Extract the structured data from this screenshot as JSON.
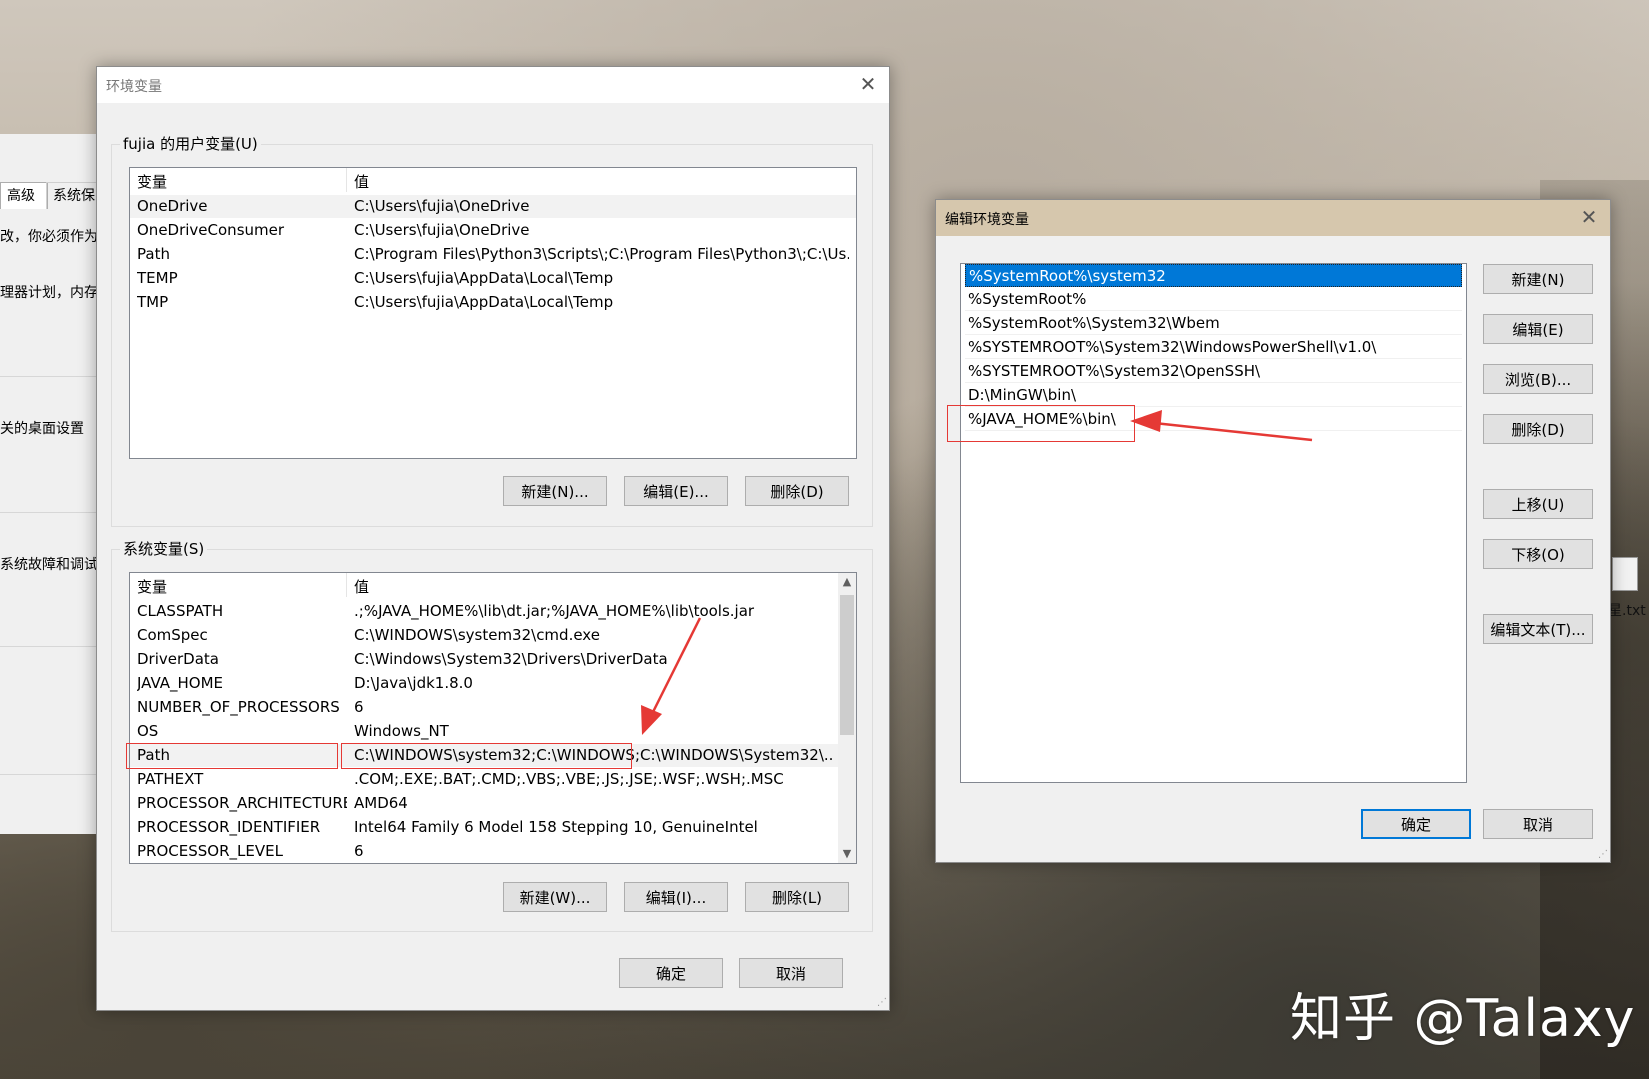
{
  "background": {
    "file_label": "星.txt",
    "watermark": "知乎 @Talaxy"
  },
  "system_properties": {
    "tabs": [
      "高级",
      "系统保"
    ],
    "texts": [
      "改，你必须作为",
      "理器计划，内存",
      "关的桌面设置",
      "系统故障和调试信"
    ]
  },
  "env_dialog": {
    "title": "环境变量",
    "user_group_label": "fujia 的用户变量(U)",
    "columns": [
      "变量",
      "值"
    ],
    "user_vars": [
      {
        "name": "OneDrive",
        "value": "C:\\Users\\fujia\\OneDrive"
      },
      {
        "name": "OneDriveConsumer",
        "value": "C:\\Users\\fujia\\OneDrive"
      },
      {
        "name": "Path",
        "value": "C:\\Program Files\\Python3\\Scripts\\;C:\\Program Files\\Python3\\;C:\\Us..."
      },
      {
        "name": "TEMP",
        "value": "C:\\Users\\fujia\\AppData\\Local\\Temp"
      },
      {
        "name": "TMP",
        "value": "C:\\Users\\fujia\\AppData\\Local\\Temp"
      }
    ],
    "user_buttons": {
      "new": "新建(N)...",
      "edit": "编辑(E)...",
      "delete": "删除(D)"
    },
    "system_group_label": "系统变量(S)",
    "system_vars": [
      {
        "name": "CLASSPATH",
        "value": ".;%JAVA_HOME%\\lib\\dt.jar;%JAVA_HOME%\\lib\\tools.jar"
      },
      {
        "name": "ComSpec",
        "value": "C:\\WINDOWS\\system32\\cmd.exe"
      },
      {
        "name": "DriverData",
        "value": "C:\\Windows\\System32\\Drivers\\DriverData"
      },
      {
        "name": "JAVA_HOME",
        "value": "D:\\Java\\jdk1.8.0"
      },
      {
        "name": "NUMBER_OF_PROCESSORS",
        "value": "6"
      },
      {
        "name": "OS",
        "value": "Windows_NT"
      },
      {
        "name": "Path",
        "value": "C:\\WINDOWS\\system32;C:\\WINDOWS;C:\\WINDOWS\\System32\\..."
      },
      {
        "name": "PATHEXT",
        "value": ".COM;.EXE;.BAT;.CMD;.VBS;.VBE;.JS;.JSE;.WSF;.WSH;.MSC"
      },
      {
        "name": "PROCESSOR_ARCHITECTURE",
        "value": "AMD64"
      },
      {
        "name": "PROCESSOR_IDENTIFIER",
        "value": "Intel64 Family 6 Model 158 Stepping 10, GenuineIntel"
      },
      {
        "name": "PROCESSOR_LEVEL",
        "value": "6"
      }
    ],
    "system_buttons": {
      "new": "新建(W)...",
      "edit": "编辑(I)...",
      "delete": "删除(L)"
    },
    "ok": "确定",
    "cancel": "取消"
  },
  "edit_dialog": {
    "title": "编辑环境变量",
    "entries": [
      "%SystemRoot%\\system32",
      "%SystemRoot%",
      "%SystemRoot%\\System32\\Wbem",
      "%SYSTEMROOT%\\System32\\WindowsPowerShell\\v1.0\\",
      "%SYSTEMROOT%\\System32\\OpenSSH\\",
      "D:\\MinGW\\bin\\",
      "%JAVA_HOME%\\bin\\"
    ],
    "buttons": {
      "new": "新建(N)",
      "edit": "编辑(E)",
      "browse": "浏览(B)...",
      "delete": "删除(D)",
      "move_up": "上移(U)",
      "move_down": "下移(O)",
      "edit_text": "编辑文本(T)..."
    },
    "ok": "确定",
    "cancel": "取消"
  },
  "colors": {
    "selection": "#0078d7",
    "annotation": "#e53935",
    "dialog_bg": "#f0f0f0"
  }
}
